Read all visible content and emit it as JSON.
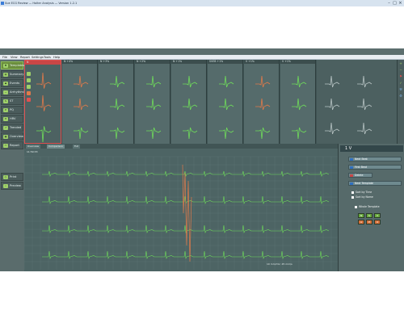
{
  "window": {
    "title": "Sue ECG Review — Holter Analysis — Version 1.2.1"
  },
  "menu": [
    "File",
    "View",
    "Report",
    "Settings",
    "Tools",
    "Help"
  ],
  "nav": [
    {
      "label": "Templates",
      "icon": "templates-icon",
      "active": true
    },
    {
      "label": "Summary",
      "icon": "summary-icon"
    },
    {
      "label": "Events",
      "icon": "events-icon"
    },
    {
      "label": "Arrhythmias",
      "icon": "arrhythmias-icon"
    },
    {
      "label": "ST",
      "icon": "st-icon"
    },
    {
      "label": "PQ",
      "icon": "pq-icon"
    },
    {
      "label": "HRV",
      "icon": "hrv-icon"
    },
    {
      "label": "Trended",
      "icon": "trended-icon"
    },
    {
      "label": "Overview",
      "icon": "overview-icon"
    },
    {
      "label": "Report",
      "icon": "report-icon"
    }
  ],
  "nav_bottom": [
    {
      "label": "Print",
      "icon": "print-icon"
    },
    {
      "label": "Preview",
      "icon": "preview-icon"
    }
  ],
  "templates": [
    {
      "label": "N",
      "pct": ""
    },
    {
      "label": "N",
      "pct": "+4%"
    },
    {
      "label": "N",
      "pct": "+3%"
    },
    {
      "label": "N",
      "pct": "+2%"
    },
    {
      "label": "N",
      "pct": "+1%"
    },
    {
      "label": "SVEB",
      "pct": "+1%"
    },
    {
      "label": "V",
      "pct": "+1%"
    },
    {
      "label": "V",
      "pct": "+1%"
    }
  ],
  "strip_tabs": [
    "Overview",
    "Comparison",
    "Full"
  ],
  "strip_time": "11:59:33",
  "strip_scale": "10 mm/mV, 25 mm/s",
  "right_panel": {
    "header": "1 V",
    "buttons": [
      "Next Beat",
      "First Beat",
      "Delete",
      "Next Template"
    ],
    "options": [
      "Sort by Time",
      "Sort by Name",
      "Whole Template"
    ]
  },
  "colors": {
    "bg": "#5c6e6e",
    "accent": "#8cbb55",
    "trace": "#6fdc5a",
    "abnormal": "#e07a4a"
  }
}
